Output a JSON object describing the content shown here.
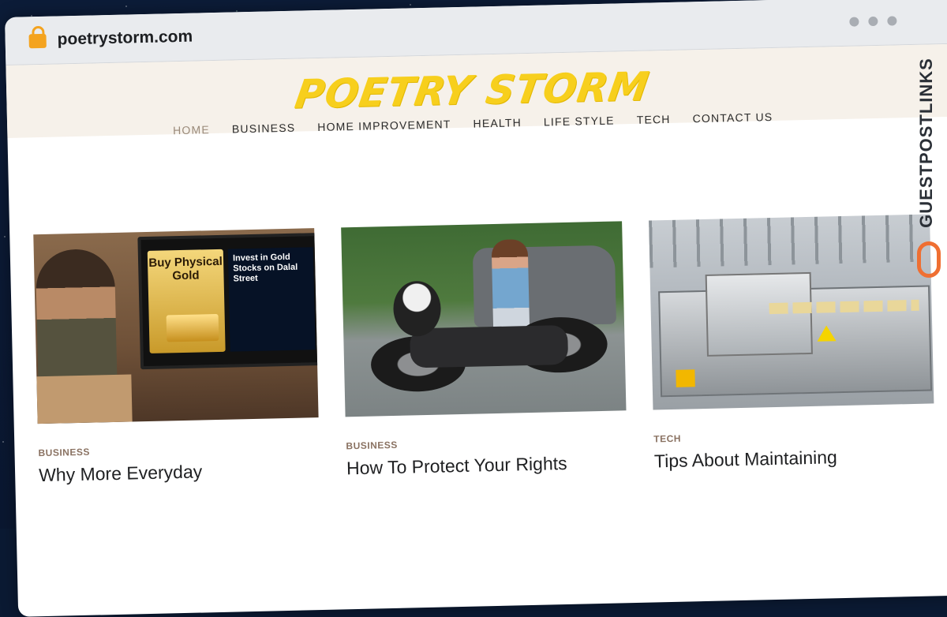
{
  "browser": {
    "url": "poetrystorm.com"
  },
  "site": {
    "logo": "POETRY STORM",
    "nav": [
      "HOME",
      "BUSINESS",
      "HOME IMPROVEMENT",
      "HEALTH",
      "LIFE STYLE",
      "TECH",
      "CONTACT US"
    ],
    "active_nav": "HOME",
    "logo_color": "#f7cf1d"
  },
  "cards": [
    {
      "category": "BUSINESS",
      "title": "Why More Everyday",
      "image": {
        "panel_text": "Buy Physical Gold",
        "chart_text": "Invest in Gold Stocks on Dalal Street"
      }
    },
    {
      "category": "BUSINESS",
      "title": "How To Protect Your Rights"
    },
    {
      "category": "TECH",
      "title": "Tips About Maintaining"
    }
  ],
  "side_brand": {
    "text": "GUESTPOSTLINKS",
    "accent": "#ef6f32"
  }
}
